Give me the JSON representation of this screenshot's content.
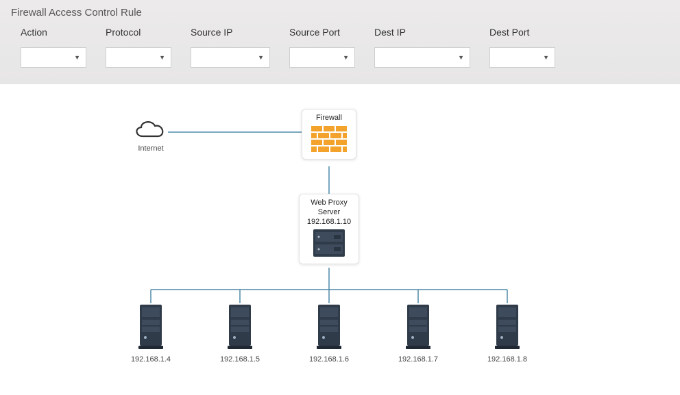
{
  "panel": {
    "title": "Firewall Access Control Rule",
    "fields": {
      "action": {
        "label": "Action",
        "value": ""
      },
      "protocol": {
        "label": "Protocol",
        "value": ""
      },
      "source_ip": {
        "label": "Source IP",
        "value": ""
      },
      "source_port": {
        "label": "Source Port",
        "value": ""
      },
      "dest_ip": {
        "label": "Dest IP",
        "value": ""
      },
      "dest_port": {
        "label": "Dest Port",
        "value": ""
      }
    }
  },
  "diagram": {
    "internet": {
      "label": "Internet"
    },
    "firewall": {
      "label": "Firewall"
    },
    "proxy": {
      "label_line1": "Web Proxy",
      "label_line2": "Server",
      "ip": "192.168.1.10"
    },
    "hosts": [
      {
        "ip": "192.168.1.4"
      },
      {
        "ip": "192.168.1.5"
      },
      {
        "ip": "192.168.1.6"
      },
      {
        "ip": "192.168.1.7"
      },
      {
        "ip": "192.168.1.8"
      }
    ]
  },
  "colors": {
    "link": "#4d89a8",
    "brick": "#f3a32b",
    "server_dark": "#2f3b49",
    "server_mid": "#3d4b5c"
  }
}
